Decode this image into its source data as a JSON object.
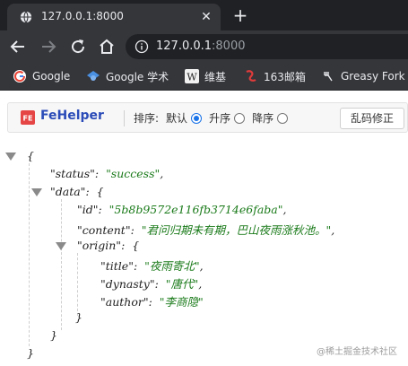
{
  "browser": {
    "tab_title": "127.0.0.1:8000",
    "close_symbol": "✕",
    "newtab_symbol": "+",
    "url_host": "127.0.0.1",
    "url_port": ":8000"
  },
  "bookmarks": [
    {
      "label": "Google",
      "icon": "google-icon"
    },
    {
      "label": "Google 学术",
      "icon": "scholar-icon"
    },
    {
      "label": "维基",
      "icon": "wikipedia-icon"
    },
    {
      "label": "163邮箱",
      "icon": "mail-163-icon"
    },
    {
      "label": "Greasy Fork",
      "icon": "greasyfork-icon"
    }
  ],
  "fehelper": {
    "logo_text": "FE",
    "name": "FeHelper",
    "sort_label": "排序:",
    "options": [
      "默认",
      "升序",
      "降序"
    ],
    "selected": "默认",
    "fix_button": "乱码修正"
  },
  "json": {
    "open_brace": "{",
    "close_brace": "}",
    "status_key": "\"status\"",
    "status_value": "\"success\"",
    "data_key": "\"data\"",
    "id_key": "\"id\"",
    "id_value": "\"5b8b9572e116fb3714e6faba\"",
    "content_key": "\"content\"",
    "content_value": "\"君问归期未有期，巴山夜雨涨秋池。\"",
    "origin_key": "\"origin\"",
    "title_key": "\"title\"",
    "title_value": "\"夜雨寄北\"",
    "dynasty_key": "\"dynasty\"",
    "dynasty_value": "\"唐代\"",
    "author_key": "\"author\"",
    "author_value": "\"李商隐\""
  },
  "watermark": "@稀土掘金技术社区"
}
